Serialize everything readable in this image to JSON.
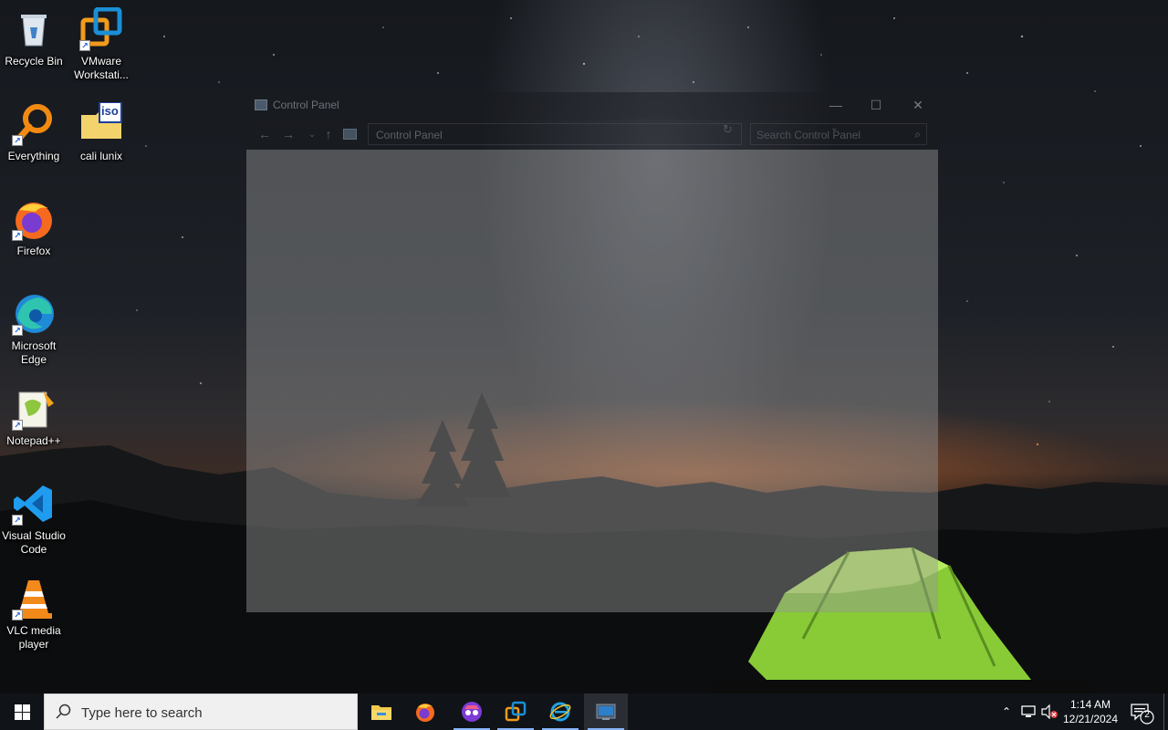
{
  "desktop": {
    "icons": [
      {
        "label": "Recycle Bin",
        "icon": "recycle-bin-icon"
      },
      {
        "label": "VMware Workstati...",
        "icon": "vmware-icon"
      },
      {
        "label": "Everything",
        "icon": "everything-search-icon"
      },
      {
        "label": "cali lunix",
        "icon": "iso-folder-icon",
        "badge": "iso"
      },
      {
        "label": "Firefox",
        "icon": "firefox-icon"
      },
      {
        "label": "Microsoft Edge",
        "icon": "edge-icon"
      },
      {
        "label": "Notepad++",
        "icon": "notepad-plus-plus-icon"
      },
      {
        "label": "Visual Studio Code",
        "icon": "vscode-icon"
      },
      {
        "label": "VLC media player",
        "icon": "vlc-icon"
      }
    ]
  },
  "window": {
    "title": "Control Panel",
    "address": "Control Panel",
    "search_placeholder": "Search Control Panel"
  },
  "taskbar": {
    "search_placeholder": "Type here to search",
    "apps": [
      "file-explorer-icon",
      "firefox-icon",
      "incognito-browser-icon",
      "vmware-icon",
      "internet-explorer-icon",
      "control-panel-icon"
    ],
    "time": "1:14 AM",
    "date": "12/21/2024",
    "notification_count": "2"
  },
  "colors": {
    "taskbar": "#101418",
    "accent": "#8ab4f8",
    "tent": "#8fd63a"
  }
}
